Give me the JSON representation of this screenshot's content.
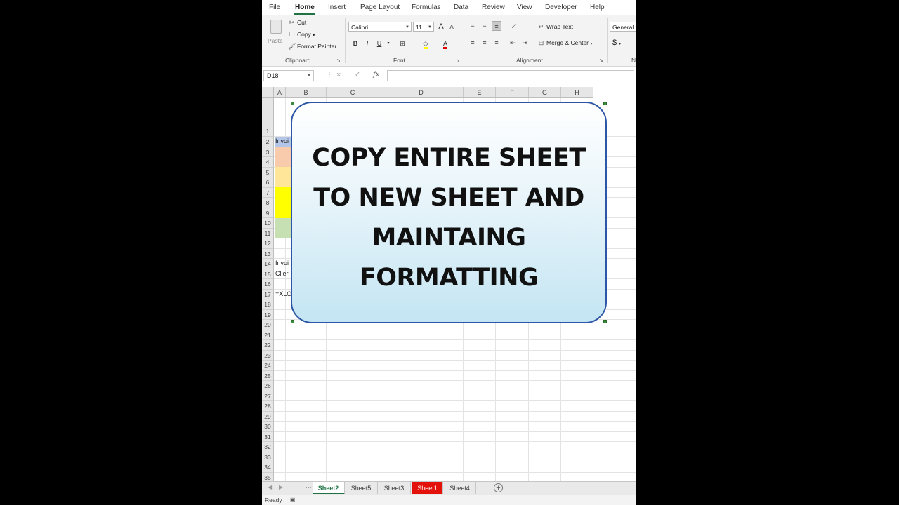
{
  "ribbon_tabs": [
    "File",
    "Home",
    "Insert",
    "Page Layout",
    "Formulas",
    "Data",
    "Review",
    "View",
    "Developer",
    "Help"
  ],
  "ribbon": {
    "clipboard": {
      "paste": "Paste",
      "cut": "Cut",
      "copy": "Copy",
      "format_painter": "Format Painter",
      "label": "Clipboard"
    },
    "font": {
      "name": "Calibri",
      "size": "11",
      "label": "Font",
      "bold": "B",
      "italic": "I",
      "underline": "U",
      "grow": "A",
      "shrink": "A"
    },
    "alignment": {
      "wrap_text": "Wrap Text",
      "merge_center": "Merge & Center",
      "label": "Alignment"
    },
    "number": {
      "format": "General",
      "currency": "$",
      "label": "N"
    }
  },
  "formula_bar": {
    "name_box": "D18",
    "fx": "fx",
    "cancel": "×",
    "enter": "✓",
    "value": ""
  },
  "grid": {
    "columns": [
      "A",
      "B",
      "C",
      "D",
      "E",
      "F",
      "G",
      "H"
    ],
    "rows": [
      "1",
      "2",
      "3",
      "4",
      "5",
      "6",
      "7",
      "8",
      "9",
      "10",
      "11",
      "12",
      "13",
      "14",
      "15",
      "16",
      "17",
      "18",
      "19",
      "20",
      "21",
      "22",
      "23",
      "24",
      "25",
      "26",
      "27",
      "28",
      "29",
      "30",
      "31",
      "32",
      "33",
      "34",
      "35"
    ],
    "cells": {
      "A2": "Invoi",
      "A14": "Invoi",
      "A15": "Clier",
      "A17": "=XLO"
    },
    "fill_colors": {
      "header": "#b4c6e7",
      "orange": "#f8cbad",
      "yellow_light": "#ffe699",
      "yellow": "#ffff00",
      "green": "#c6e0b4"
    }
  },
  "overlay": {
    "lines": [
      "COPY ENTIRE SHEET",
      "TO NEW SHEET AND",
      "MAINTAING",
      "FORMATTING"
    ]
  },
  "sheet_tabs": [
    {
      "label": "Sheet2",
      "state": "active"
    },
    {
      "label": "Sheet5",
      "state": "normal"
    },
    {
      "label": "Sheet3",
      "state": "normal"
    },
    {
      "label": "Sheet1",
      "state": "red"
    },
    {
      "label": "Sheet4",
      "state": "normal"
    }
  ],
  "add_sheet": "+",
  "status": {
    "text": "Ready"
  },
  "accent_color": "#217346"
}
